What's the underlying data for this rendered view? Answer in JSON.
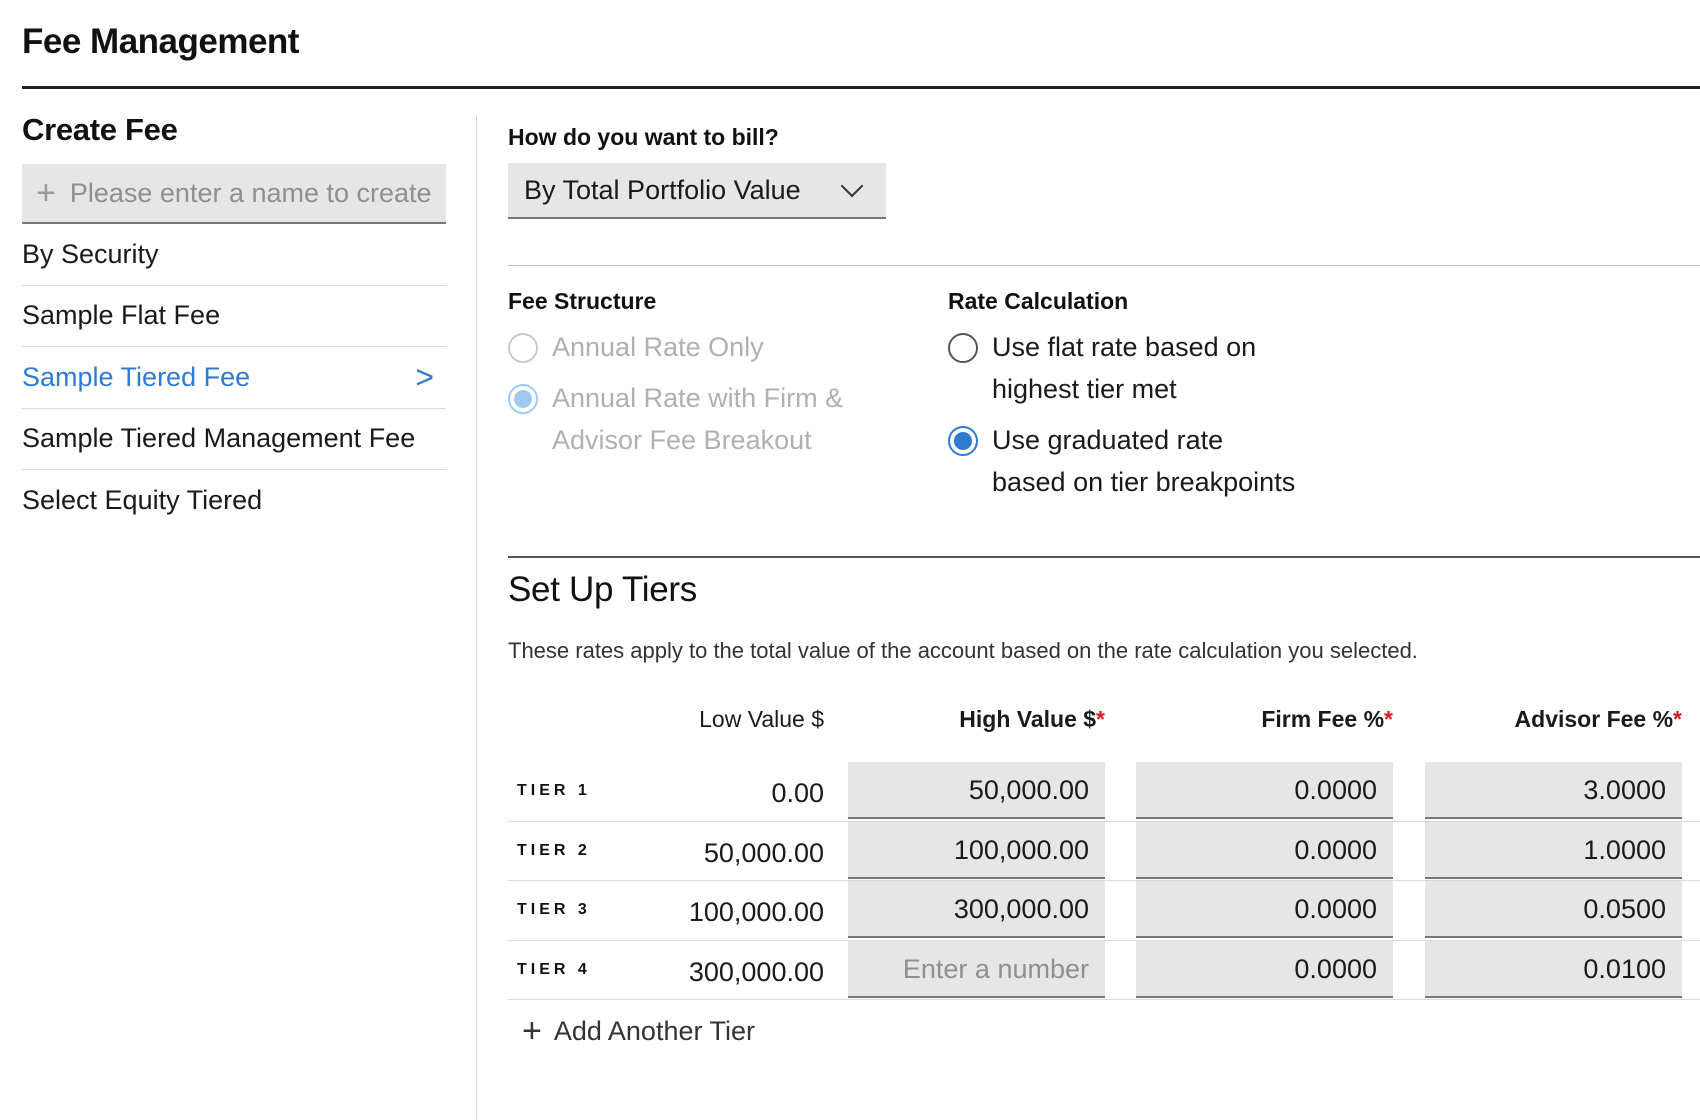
{
  "page": {
    "title": "Fee Management"
  },
  "sidebar": {
    "heading": "Create Fee",
    "create_placeholder": "Please enter a name to create",
    "items": [
      {
        "label": "By Security",
        "active": false
      },
      {
        "label": "Sample Flat Fee",
        "active": false
      },
      {
        "label": "Sample Tiered Fee",
        "active": true
      },
      {
        "label": "Sample Tiered Management Fee",
        "active": false
      },
      {
        "label": "Select Equity Tiered",
        "active": false
      }
    ]
  },
  "billing": {
    "label": "How do you want to bill?",
    "selected": "By Total Portfolio Value"
  },
  "fee_structure": {
    "heading": "Fee Structure",
    "options": [
      {
        "lines": [
          "Annual Rate Only"
        ],
        "selected": false,
        "disabled": true
      },
      {
        "lines": [
          "Annual Rate with Firm &",
          "Advisor Fee Breakout"
        ],
        "selected": true,
        "disabled": true
      }
    ]
  },
  "rate_calculation": {
    "heading": "Rate Calculation",
    "options": [
      {
        "lines": [
          "Use flat rate based on",
          "highest tier met"
        ],
        "selected": false,
        "disabled": false
      },
      {
        "lines": [
          "Use graduated rate",
          "based on tier breakpoints"
        ],
        "selected": true,
        "disabled": false
      }
    ]
  },
  "tiers": {
    "title": "Set Up Tiers",
    "description": "These rates apply to the total value of the account based on the rate calculation you selected.",
    "columns": {
      "low": "Low Value $",
      "high": "High Value $",
      "firm": "Firm Fee %",
      "advisor": "Advisor Fee %"
    },
    "required_mark": "*",
    "high_placeholder": "Enter a number",
    "rows": [
      {
        "name": "TIER 1",
        "low": "0.00",
        "high": "50,000.00",
        "firm": "0.0000",
        "advisor": "3.0000"
      },
      {
        "name": "TIER 2",
        "low": "50,000.00",
        "high": "100,000.00",
        "firm": "0.0000",
        "advisor": "1.0000"
      },
      {
        "name": "TIER 3",
        "low": "100,000.00",
        "high": "300,000.00",
        "firm": "0.0000",
        "advisor": "0.0500"
      },
      {
        "name": "TIER 4",
        "low": "300,000.00",
        "high": "",
        "firm": "0.0000",
        "advisor": "0.0100"
      }
    ],
    "add_label": "Add Another Tier"
  },
  "colors": {
    "accent": "#2f7bd1",
    "required": "#d21d1d",
    "input_bg": "#e6e6e6"
  },
  "icons": {
    "plus": "plus-icon",
    "chevron_down": "chevron-down-icon",
    "chevron_right": "chevron-right-icon"
  }
}
